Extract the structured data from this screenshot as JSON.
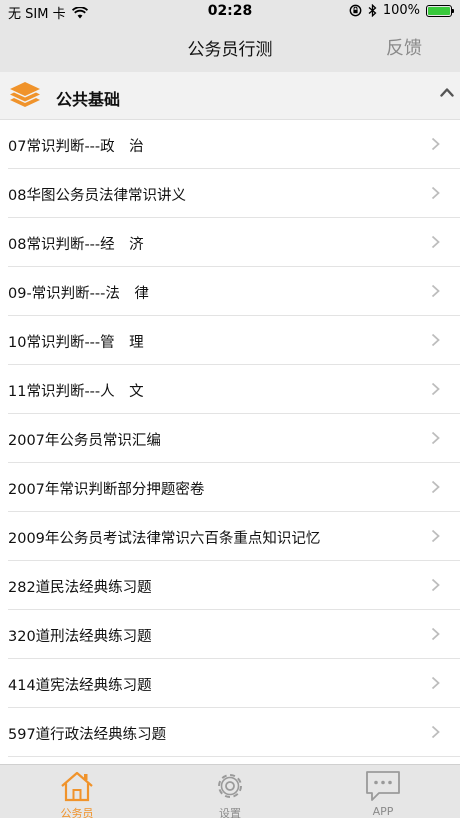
{
  "status_bar": {
    "carrier": "无 SIM 卡",
    "time": "02:28",
    "battery": "100%"
  },
  "nav": {
    "title": "公务员行测",
    "action": "反馈"
  },
  "section": {
    "title": "公共基础",
    "icon": "layers-icon"
  },
  "items": [
    {
      "label": "07常识判断---政　治"
    },
    {
      "label": "08华图公务员法律常识讲义"
    },
    {
      "label": "08常识判断---经　济"
    },
    {
      "label": "09-常识判断---法　律"
    },
    {
      "label": "10常识判断---管　理"
    },
    {
      "label": "11常识判断---人　文"
    },
    {
      "label": "2007年公务员常识汇编"
    },
    {
      "label": "2007年常识判断部分押题密卷"
    },
    {
      "label": "2009年公务员考试法律常识六百条重点知识记忆"
    },
    {
      "label": "282道民法经典练习题"
    },
    {
      "label": "320道刑法经典练习题"
    },
    {
      "label": "414道宪法经典练习题"
    },
    {
      "label": "597道行政法经典练习题"
    }
  ],
  "tabs": [
    {
      "label": "公务员",
      "icon": "house-icon",
      "active": true
    },
    {
      "label": "设置",
      "icon": "gear-icon",
      "active": false
    },
    {
      "label": "APP",
      "icon": "chat-bubble-icon",
      "active": false
    }
  ],
  "colors": {
    "accent": "#f0932b",
    "bar_background": "#e6e6e6",
    "inactive": "#8a8a8a"
  }
}
